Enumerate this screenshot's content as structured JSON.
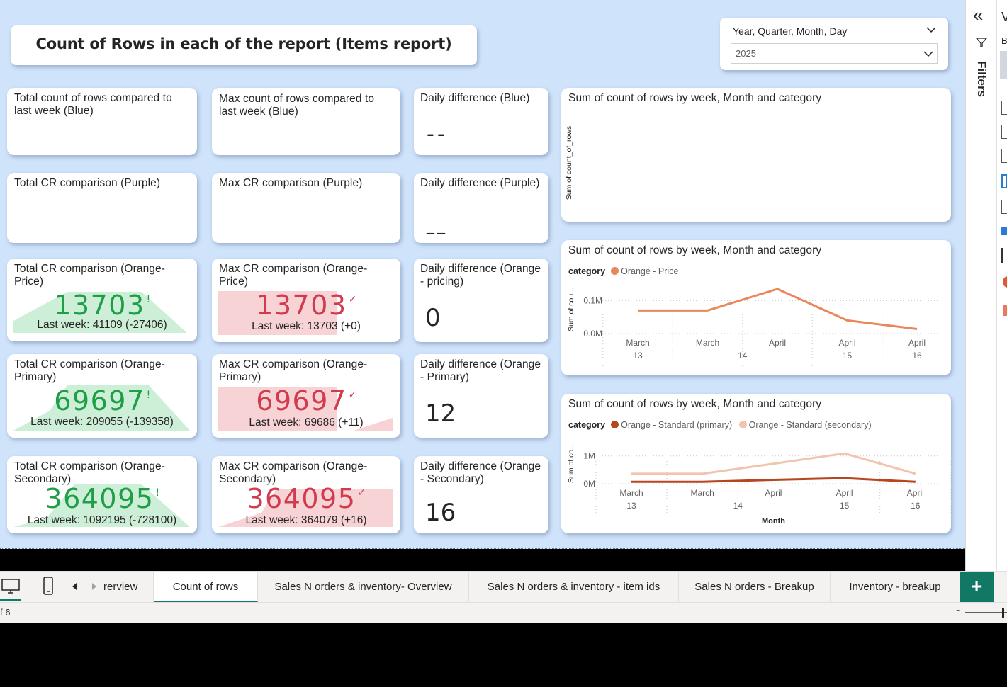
{
  "header": {
    "title": "Count of Rows in each of the report (Items report)"
  },
  "slicer": {
    "label": "Year, Quarter, Month, Day",
    "value": "2025"
  },
  "cards": {
    "blue_total_title": "Total count of rows compared to last week (Blue)",
    "blue_max_title": "Max count of rows compared to last week (Blue)",
    "blue_daily_title": "Daily difference (Blue)",
    "blue_daily_value": "--",
    "purple_total_title": "Total CR comparison (Purple)",
    "purple_max_title": "Max CR comparison (Purple)",
    "purple_daily_title": "Daily difference (Purple)",
    "purple_daily_value": "__",
    "price_total_title": "Total CR comparison (Orange-Price)",
    "price_total_value": "13703",
    "price_total_lw": "Last week: 41109 (-27406)",
    "price_max_title": "Max CR comparison (Orange-Price)",
    "price_max_value": "13703",
    "price_max_lw": "Last week: 13703 (+0)",
    "price_daily_title": "Daily difference (Orange - pricing)",
    "price_daily_value": "0",
    "primary_total_title": "Total CR comparison (Orange-Primary)",
    "primary_total_value": "69697",
    "primary_total_lw": "Last week: 209055 (-139358)",
    "primary_max_title": "Max CR comparison (Orange-Primary)",
    "primary_max_value": "69697",
    "primary_max_lw": "Last week: 69686 (+11)",
    "primary_daily_title": "Daily difference (Orange - Primary)",
    "primary_daily_value": "12",
    "secondary_total_title": "Total CR comparison (Orange-Secondary)",
    "secondary_total_value": "364095",
    "secondary_total_lw": "Last week: 1092195 (-728100)",
    "secondary_max_title": "Max CR comparison (Orange-Secondary)",
    "secondary_max_value": "364095",
    "secondary_max_lw": "Last week: 364079 (+16)",
    "secondary_daily_title": "Daily difference (Orange - Secondary)",
    "secondary_daily_value": "16",
    "green_mark": "!",
    "red_mark": "✓"
  },
  "chart_data": [
    {
      "type": "line",
      "title": "Sum of count of rows by week, Month and category",
      "ylabel": "Sum of count_of_rows",
      "xlabel": "",
      "series": []
    },
    {
      "type": "line",
      "title": "Sum of count of rows by week, Month and category",
      "legend_title": "category",
      "ylabel": "Sum of cou...",
      "xlabel": "",
      "x_groups": [
        {
          "month": "March",
          "weeks": [
            "13",
            "14"
          ]
        },
        {
          "month": "April",
          "weeks": [
            "14",
            "15",
            "16"
          ]
        }
      ],
      "x_top": [
        "March",
        "March",
        "April",
        "April",
        "April"
      ],
      "x_bottom": [
        "13",
        "14",
        "15",
        "16"
      ],
      "yticks": [
        "0.1M",
        "0.0M"
      ],
      "ylim": [
        0,
        0.15
      ],
      "series": [
        {
          "name": "Orange - Price",
          "color": "#e8875a",
          "values": [
            0.07,
            0.07,
            0.135,
            0.04,
            0.014
          ]
        }
      ]
    },
    {
      "type": "line",
      "title": "Sum of count of rows by week, Month and category",
      "legend_title": "category",
      "ylabel": "Sum of co...",
      "xlabel": "Month",
      "x_top": [
        "March",
        "March",
        "April",
        "April",
        "April"
      ],
      "x_bottom": [
        "13",
        "14",
        "15",
        "16"
      ],
      "yticks": [
        "1M",
        "0M"
      ],
      "ylim": [
        0,
        1.4
      ],
      "series": [
        {
          "name": "Orange - Standard (primary)",
          "color": "#b5461f",
          "values": [
            0.07,
            0.07,
            0.14,
            0.2,
            0.07
          ]
        },
        {
          "name": "Orange - Standard (secondary)",
          "color": "#f2c4ae",
          "values": [
            0.36,
            0.36,
            0.72,
            1.09,
            0.36
          ]
        }
      ]
    }
  ],
  "tabs": [
    {
      "label": "rerview",
      "active": false
    },
    {
      "label": "Count of rows",
      "active": true
    },
    {
      "label": "Sales N orders & inventory- Overview",
      "active": false
    },
    {
      "label": "Sales N orders & inventory - item ids",
      "active": false
    },
    {
      "label": "Sales N orders - Breakup",
      "active": false
    },
    {
      "label": "Inventory - breakup",
      "active": false
    }
  ],
  "add_tab": "+",
  "status": {
    "page": "f 6",
    "zoom_minus": "-"
  },
  "rightpane": {
    "filters_label": "Filters",
    "collapse": "«",
    "letter_v": "V",
    "letter_b": "B"
  }
}
